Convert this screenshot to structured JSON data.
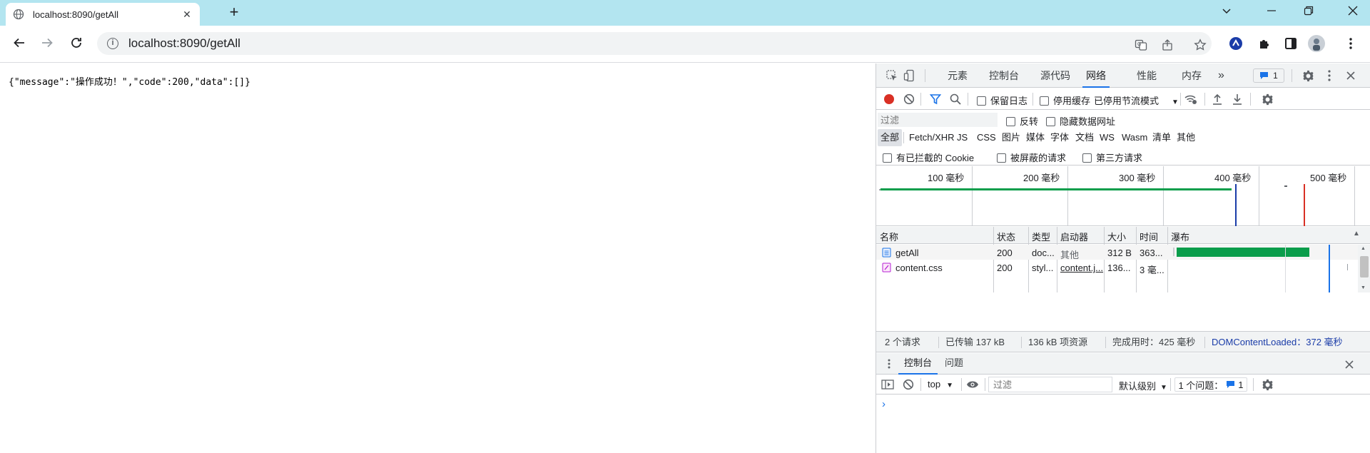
{
  "browser": {
    "tab_title": "localhost:8090/getAll",
    "url": "localhost:8090/getAll"
  },
  "page": {
    "json_text": "{\"message\":\"操作成功！\",\"code\":200,\"data\":[]}"
  },
  "devtools": {
    "tabs": [
      "元素",
      "控制台",
      "源代码",
      "网络",
      "性能",
      "内存"
    ],
    "active_tab": "网络",
    "issues_badge": "1",
    "toolbar": {
      "preserve_log": "保留日志",
      "disable_cache": "停用缓存",
      "throttling": "已停用节流模式"
    },
    "filter": {
      "placeholder": "过滤",
      "invert": "反转",
      "hide_data_urls": "隐藏数据网址"
    },
    "type_filters": [
      "全部",
      "Fetch/XHR",
      "JS",
      "CSS",
      "图片",
      "媒体",
      "字体",
      "文档",
      "WS",
      "Wasm",
      "清单",
      "其他"
    ],
    "extra_filters": {
      "blocked_cookies": "有已拦截的 Cookie",
      "blocked_requests": "被屏蔽的请求",
      "third_party": "第三方请求"
    },
    "timeline_ticks": [
      "100 毫秒",
      "200 毫秒",
      "300 毫秒",
      "400 毫秒",
      "500 毫秒"
    ],
    "table": {
      "headers": {
        "name": "名称",
        "status": "状态",
        "type": "类型",
        "initiator": "启动器",
        "size": "大小",
        "time": "时间",
        "waterfall": "瀑布"
      },
      "rows": [
        {
          "name": "getAll",
          "status": "200",
          "type": "doc...",
          "initiator": "其他",
          "size": "312 B",
          "time": "363..."
        },
        {
          "name": "content.css",
          "status": "200",
          "type": "styl...",
          "initiator": "content.j...",
          "size": "136...",
          "time": "3 毫..."
        }
      ]
    },
    "summary": {
      "requests": "2 个请求",
      "transferred": "已传输 137 kB",
      "resources": "136 kB 项资源",
      "finish": "完成用时：425 毫秒",
      "dcl": "DOMContentLoaded：372 毫秒"
    },
    "drawer": {
      "tabs": [
        "控制台",
        "问题"
      ],
      "context": "top",
      "filter_placeholder": "过滤",
      "levels": "默认级别",
      "issues_label": "1 个问题：",
      "issues_count": "1"
    },
    "colors": {
      "accent": "#1a73e8",
      "record": "#d93025",
      "waterfall": "#0a9d4b"
    }
  }
}
